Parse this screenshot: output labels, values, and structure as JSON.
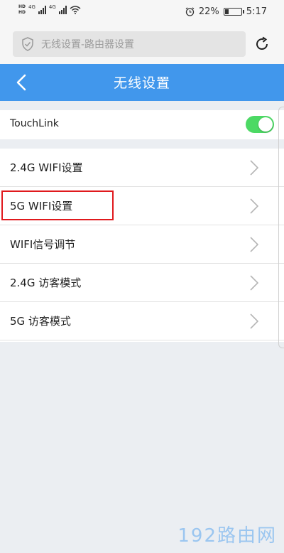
{
  "status_bar": {
    "hd1": "HD",
    "hd2": "HD",
    "net1": "4G",
    "net2": "4G",
    "battery": "22%",
    "battery_level": 0.22,
    "time": "5:17"
  },
  "browser": {
    "url": "无线设置-路由器设置"
  },
  "header": {
    "title": "无线设置"
  },
  "touchlink": {
    "label": "TouchLink",
    "enabled": true
  },
  "list": {
    "items": [
      {
        "label": "2.4G WIFI设置"
      },
      {
        "label": "5G WIFI设置"
      },
      {
        "label": "WIFI信号调节"
      },
      {
        "label": "2.4G 访客模式"
      },
      {
        "label": "5G 访客模式"
      }
    ]
  },
  "watermark": "192路由网",
  "colors": {
    "header": "#4197ec",
    "toggle_on": "#4cd964",
    "highlight": "#e0191d",
    "background": "#ebeef2"
  }
}
